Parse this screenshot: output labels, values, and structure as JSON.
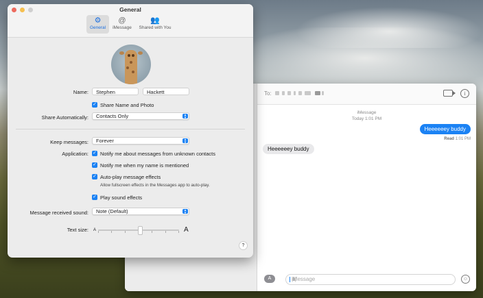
{
  "prefs": {
    "title": "General",
    "tabs": [
      {
        "label": "General",
        "icon": "gear-icon"
      },
      {
        "label": "iMessage",
        "icon": "at-icon"
      },
      {
        "label": "Shared with You",
        "icon": "people-icon"
      }
    ],
    "name_label": "Name:",
    "first_name": "Stephen",
    "last_name": "Hackett",
    "share_name_label": "Share Name and Photo",
    "share_auto_label": "Share Automatically:",
    "share_auto_value": "Contacts Only",
    "keep_messages_label": "Keep messages:",
    "keep_messages_value": "Forever",
    "application_label": "Application:",
    "opt_unknown": "Notify me about messages from unknown contacts",
    "opt_mentioned": "Notify me when my name is mentioned",
    "opt_autoplay": "Auto-play message effects",
    "opt_autoplay_note": "Allow fullscreen effects in the Messages app to auto-play.",
    "opt_sound": "Play sound effects",
    "sound_label": "Message received sound:",
    "sound_value": "Note (Default)",
    "text_size_label": "Text size:",
    "text_size_small": "A",
    "text_size_large": "A",
    "help": "?"
  },
  "messages": {
    "to_label": "To:",
    "service": "iMessage",
    "timestamp": "Today 1:01 PM",
    "outgoing": "Heeeeeey buddy",
    "read_label": "Read",
    "read_time": "1:01 PM",
    "incoming": "Heeeeeey buddy",
    "placeholder": "iMessage",
    "info": "i"
  },
  "colors": {
    "accent": "#1b82f4",
    "close": "#ed6a5e",
    "minimize": "#f5bf4f"
  }
}
